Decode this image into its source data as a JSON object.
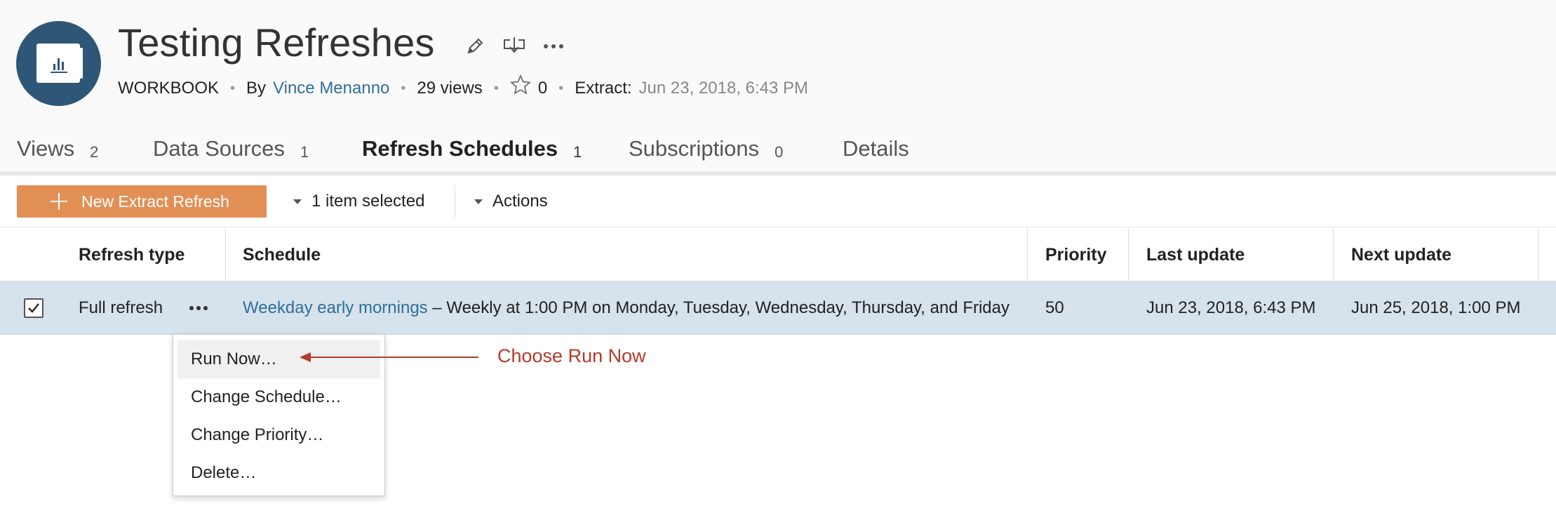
{
  "header": {
    "title": "Testing Refreshes",
    "icons": {
      "avatar": "workbook-icon",
      "edit": "pencil-icon",
      "download": "download-icon",
      "more": "ellipsis-icon"
    },
    "meta": {
      "type": "WORKBOOK",
      "by_prefix": "By",
      "owner": "Vince Menanno",
      "views": "29 views",
      "favorites": "0",
      "extract_label": "Extract:",
      "extract_date": "Jun 23, 2018, 6:43 PM"
    }
  },
  "tabs": [
    {
      "label": "Views",
      "count": "2"
    },
    {
      "label": "Data Sources",
      "count": "1"
    },
    {
      "label": "Refresh Schedules",
      "count": "1",
      "active": true
    },
    {
      "label": "Subscriptions",
      "count": "0"
    },
    {
      "label": "Details",
      "count": ""
    }
  ],
  "toolbar": {
    "new_button": "New Extract Refresh",
    "selected": "1 item selected",
    "actions": "Actions"
  },
  "table": {
    "columns": [
      "Refresh type",
      "Schedule",
      "Priority",
      "Last update",
      "Next update"
    ],
    "rows": [
      {
        "checked": true,
        "refresh_type": "Full refresh",
        "schedule_name": "Weekday early mornings",
        "schedule_detail": " – Weekly at 1:00 PM on Monday, Tuesday, Wednesday, Thursday, and Friday",
        "priority": "50",
        "last_update": "Jun 23, 2018, 6:43 PM",
        "next_update": "Jun 25, 2018, 1:00 PM"
      }
    ]
  },
  "menu": {
    "items": [
      "Run Now…",
      "Change Schedule…",
      "Change Priority…",
      "Delete…"
    ],
    "highlighted_index": 0
  },
  "annotation": {
    "text": "Choose Run Now",
    "color": "#b5392b"
  },
  "colors": {
    "accent": "#2e5677",
    "primary_button": "#e28f56",
    "link": "#2f6f9c",
    "selected_row": "#d6e2ec"
  }
}
